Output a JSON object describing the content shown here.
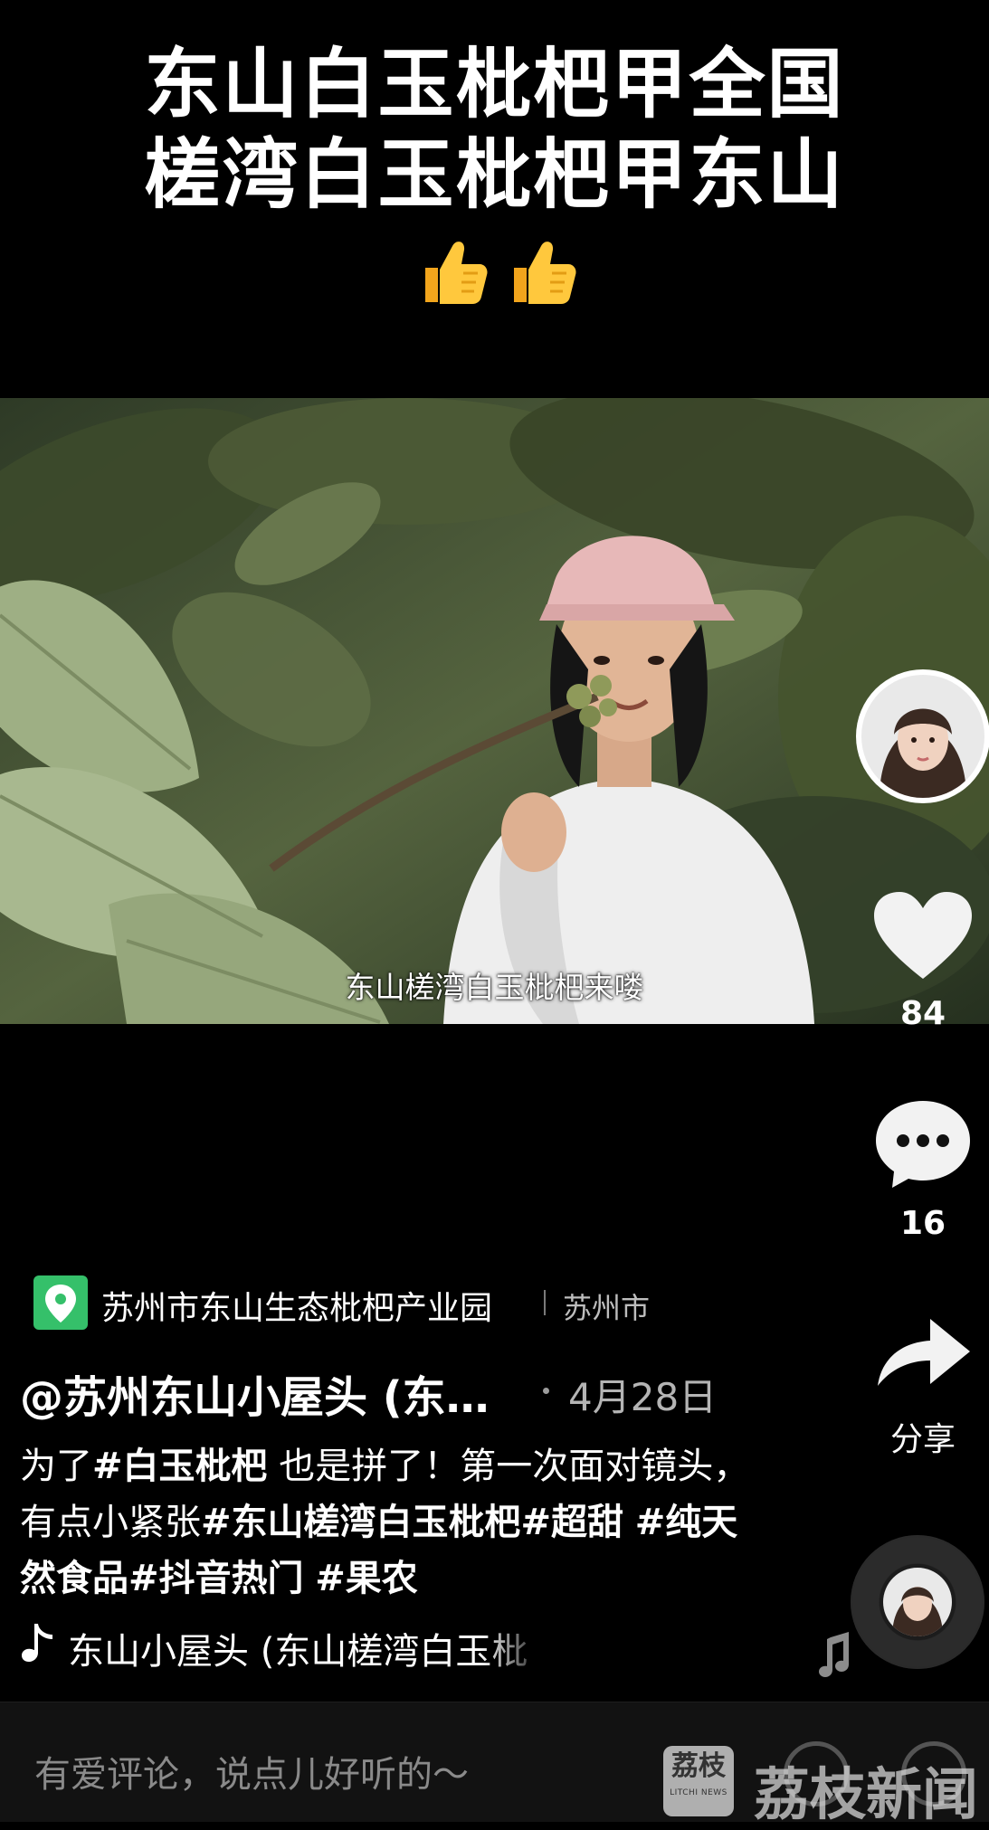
{
  "overlay_title": {
    "line1": "东山白玉枇杷甲全国",
    "line2": "槎湾白玉枇杷甲东山",
    "emoji": [
      "thumbs-up-icon",
      "thumbs-up-icon"
    ]
  },
  "video": {
    "subtitle": "东山槎湾白玉枇杷来喽"
  },
  "right_rail": {
    "like_count": "84",
    "comment_count": "16",
    "share_label": "分享"
  },
  "location": {
    "name": "苏州市东山生态枇杷产业园",
    "city": "苏州市"
  },
  "post": {
    "author": "@苏州东山小屋头 (东…",
    "date": "4月28日",
    "caption": [
      {
        "text": "为了",
        "tag": false
      },
      {
        "text": "#白玉枇杷",
        "tag": true
      },
      {
        "text": " 也是拼了！第一次面对镜头，有点小紧张",
        "tag": false
      },
      {
        "text": "#东山槎湾白玉枇杷",
        "tag": true
      },
      {
        "text": "#超甜",
        "tag": true
      },
      {
        "text": " ",
        "tag": false
      },
      {
        "text": "#纯天然食品",
        "tag": true
      },
      {
        "text": "#抖音热门",
        "tag": true
      },
      {
        "text": " ",
        "tag": false
      },
      {
        "text": "#果农",
        "tag": true
      }
    ],
    "music": "东山小屋头 (东山槎湾白玉枇"
  },
  "comment_bar": {
    "placeholder": "有爱评论，说点儿好听的～"
  },
  "watermark": {
    "logo_text": "荔枝",
    "logo_sub": "LITCHI NEWS",
    "text": "荔枝新闻"
  },
  "colors": {
    "background": "#000000",
    "location_icon": "#35c06a",
    "muted_text": "#b4b4b4"
  }
}
